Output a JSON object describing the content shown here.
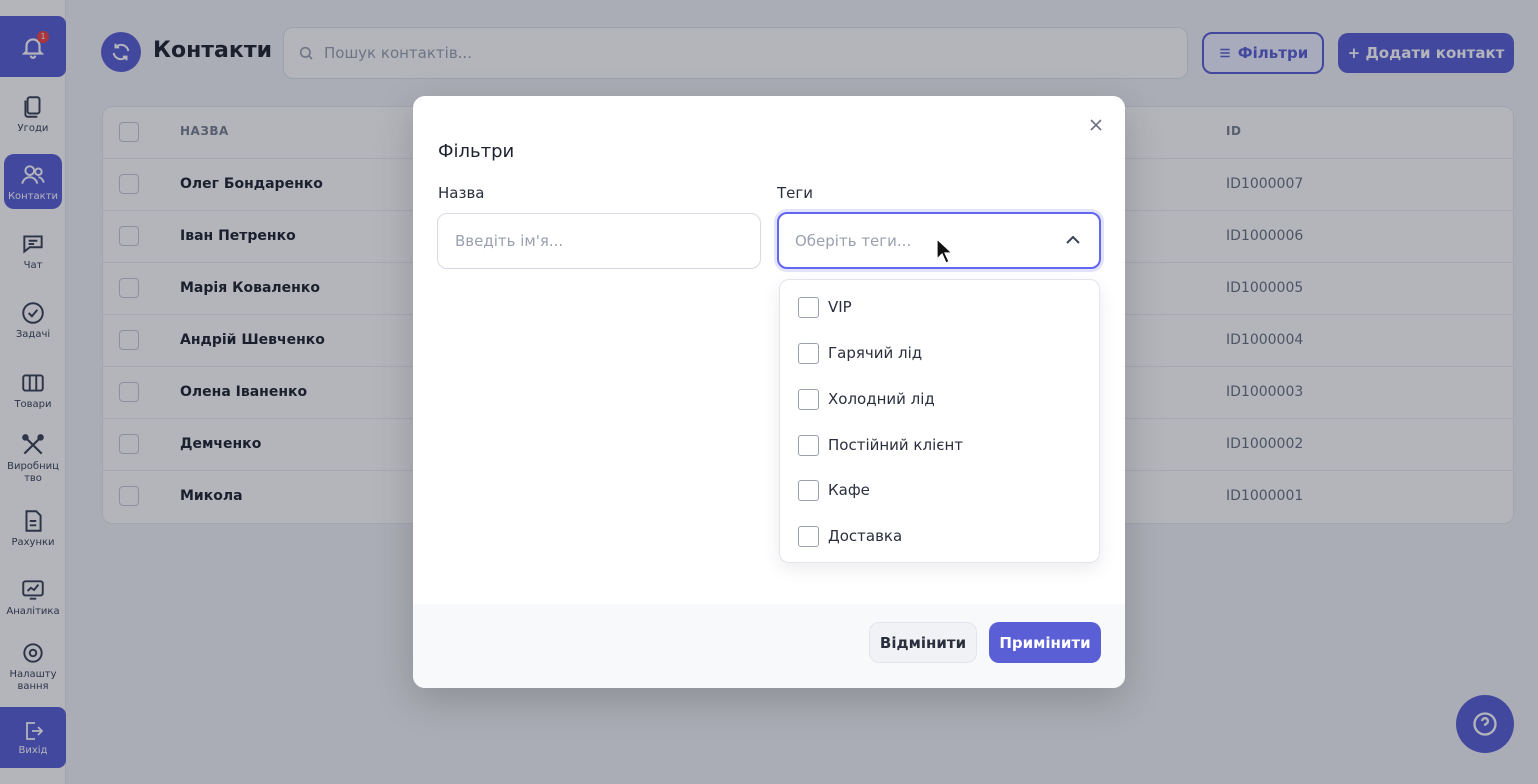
{
  "sidebar": {
    "notification_count": "1",
    "items": [
      {
        "label": "Угоди",
        "icon": "deals-icon"
      },
      {
        "label": "Контакти",
        "icon": "contacts-icon"
      },
      {
        "label": "Чат",
        "icon": "chat-icon"
      },
      {
        "label": "Задачі",
        "icon": "tasks-icon"
      },
      {
        "label": "Товари",
        "icon": "products-icon"
      },
      {
        "label": "Виробниц тво",
        "icon": "production-icon"
      },
      {
        "label": "Рахунки",
        "icon": "invoices-icon"
      },
      {
        "label": "Аналітика",
        "icon": "analytics-icon"
      },
      {
        "label": "Налашту вання",
        "icon": "settings-icon"
      }
    ],
    "logout_label": "Вихід"
  },
  "header": {
    "title": "Контакти",
    "search_placeholder": "Пошук контактів...",
    "filters_label": "Фільтри",
    "add_contact_label": "+ Додати контакт"
  },
  "table": {
    "columns": {
      "name": "НАЗВА",
      "id": "ID"
    },
    "rows": [
      {
        "name": "Олег Бондаренко",
        "id": "ID1000007"
      },
      {
        "name": "Іван Петренко",
        "id": "ID1000006"
      },
      {
        "name": "Марія Коваленко",
        "id": "ID1000005"
      },
      {
        "name": "Андрій Шевченко",
        "id": "ID1000004"
      },
      {
        "name": "Олена Іваненко",
        "id": "ID1000003"
      },
      {
        "name": "Демченко",
        "id": "ID1000002"
      },
      {
        "name": "Микола",
        "id": "ID1000001"
      }
    ]
  },
  "modal": {
    "title": "Фільтри",
    "name_label": "Назва",
    "name_placeholder": "Введіть ім'я...",
    "tags_label": "Теги",
    "tags_placeholder": "Оберіть теги...",
    "tag_options": [
      "VIP",
      "Гарячий лід",
      "Холодний лід",
      "Постійний клієнт",
      "Кафе",
      "Доставка"
    ],
    "cancel_label": "Відмінити",
    "apply_label": "Примінити"
  },
  "colors": {
    "accent": "#5b5fd6",
    "focus": "#6366f1"
  }
}
